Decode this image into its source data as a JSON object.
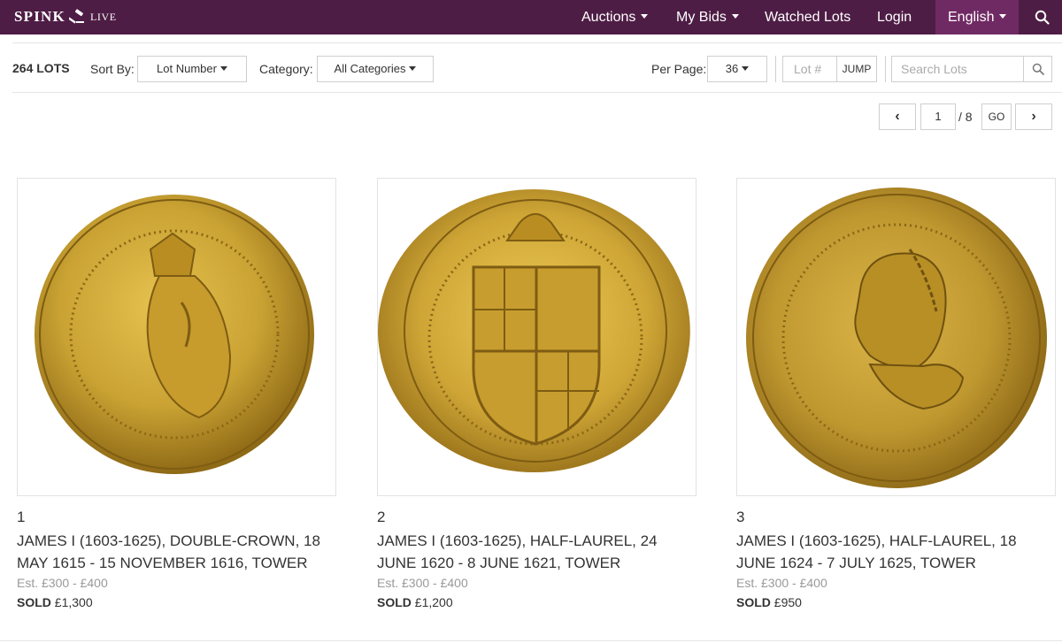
{
  "brand": {
    "name": "SPINK",
    "sub": "LIVE"
  },
  "nav": {
    "auctions": "Auctions",
    "my_bids": "My Bids",
    "watched_lots": "Watched Lots",
    "login": "Login",
    "language": "English",
    "search_icon": "search-icon"
  },
  "toolbar": {
    "lots_count": "264 LOTS",
    "sort_label": "Sort By:",
    "sort_value": "Lot Number",
    "category_label": "Category:",
    "category_value": "All Categories",
    "per_page_label": "Per Page:",
    "per_page_value": "36",
    "lot_placeholder": "Lot #",
    "jump_label": "JUMP",
    "search_placeholder": "Search Lots"
  },
  "pagination": {
    "prev": "‹",
    "current_page": "1",
    "total": "/ 8",
    "go": "GO",
    "next": "›"
  },
  "lots": [
    {
      "number": "1",
      "title": "JAMES I (1603-1625), DOUBLE-CROWN, 18 MAY 1615 - 15 NOVEMBER 1616, TOWER",
      "estimate": "Est. £300 - £400",
      "sold_label": "SOLD",
      "sold_price": "£1,300"
    },
    {
      "number": "2",
      "title": "JAMES I (1603-1625), HALF-LAUREL, 24 JUNE 1620 - 8 JUNE 1621, TOWER",
      "estimate": "Est. £300 - £400",
      "sold_label": "SOLD",
      "sold_price": "£1,200"
    },
    {
      "number": "3",
      "title": "JAMES I (1603-1625), HALF-LAUREL, 18 JUNE 1624 - 7 JULY 1625, TOWER",
      "estimate": "Est. £300 - £400",
      "sold_label": "SOLD",
      "sold_price": "£950"
    }
  ],
  "colors": {
    "nav_bg": "#4e1d45",
    "nav_active": "#702a63",
    "gold": "#c9a233"
  }
}
